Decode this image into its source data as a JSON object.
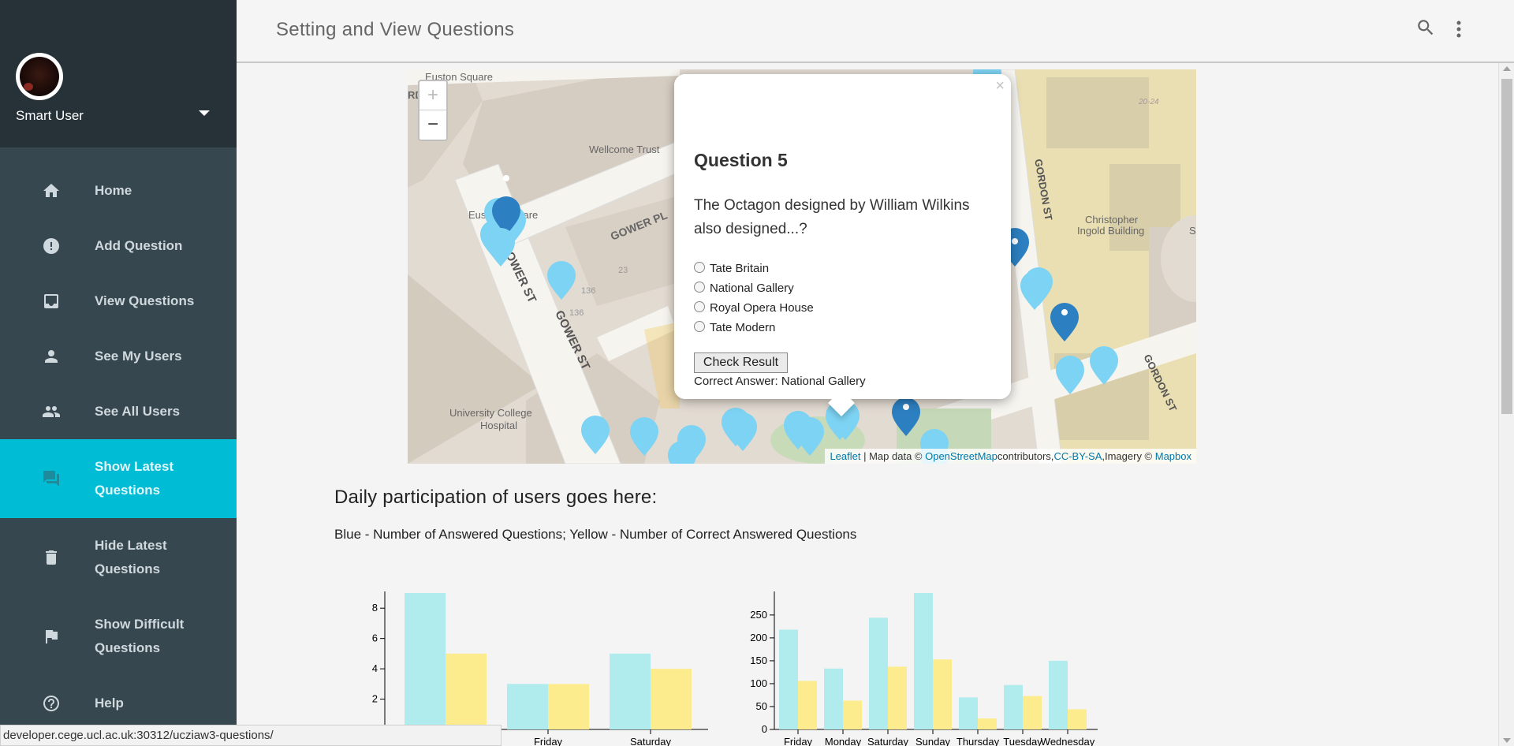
{
  "sidebar": {
    "user_name": "Smart User",
    "items": [
      {
        "label": "Home",
        "icon": "home-icon"
      },
      {
        "label": "Add Question",
        "icon": "alert-icon"
      },
      {
        "label": "View Questions",
        "icon": "inbox-icon"
      },
      {
        "label": "See My Users",
        "icon": "person-icon"
      },
      {
        "label": "See All Users",
        "icon": "people-icon"
      },
      {
        "label": "Show Latest Questions",
        "icon": "forum-icon",
        "active": true
      },
      {
        "label": "Hide Latest Questions",
        "icon": "trash-icon"
      },
      {
        "label": "Show Difficult Questions",
        "icon": "flag-icon"
      },
      {
        "label": "Help",
        "icon": "help-icon"
      }
    ],
    "active_color": "#00bcd4"
  },
  "header": {
    "title": "Setting and View Questions"
  },
  "map": {
    "zoom_in": "+",
    "zoom_out": "−",
    "labels": {
      "euston_square": "Euston Square",
      "euston_square_2": "Eus",
      "euston_square_3": "quare",
      "wellcome": "Wellcome Trust",
      "gower_pl": "GOWER PL",
      "gower_st_1": "GOWER ST",
      "gower_st_2": "GOWER ST",
      "gordon_st": "GORDON ST",
      "gordon_st_2": "GORDON ST",
      "christopher": "Christopher",
      "ingold": "Ingold Building",
      "ucl_hospital_1": "University College",
      "ucl_hospital_2": "Hospital",
      "n136a": "136",
      "n136b": "136",
      "n23": "23",
      "n2024": "20-24",
      "rd": "RD",
      "s": "S"
    },
    "attribution": {
      "leaflet": "Leaflet",
      "sep1": " | Map data © ",
      "osm": "OpenStreetMap",
      "contrib": "contributors,",
      "cc": "CC-BY-SA",
      "imagery": ",Imagery © ",
      "mapbox": "Mapbox"
    },
    "popup": {
      "close": "×",
      "title": "Question 5",
      "question": "The Octagon designed by William Wilkins also designed...?",
      "options": [
        "Tate Britain",
        "National Gallery",
        "Royal Opera House",
        "Tate Modern"
      ],
      "button": "Check Result",
      "correct": "Correct Answer: National Gallery"
    }
  },
  "main": {
    "section_title": "Daily participation of users goes here:",
    "legend": "Blue - Number of Answered Questions; Yellow - Number of Correct Answered Questions"
  },
  "status_bar": {
    "url": "developer.cege.ucl.ac.uk:30312/ucziaw3-questions/"
  },
  "chart_data": [
    {
      "type": "bar",
      "categories": [
        "",
        "Friday",
        "Saturday"
      ],
      "series": [
        {
          "values": [
            9,
            3,
            5
          ],
          "color": "#b0ebee"
        },
        {
          "values": [
            5,
            3,
            4
          ],
          "color": "#fdec8e"
        }
      ],
      "yticks": [
        2,
        4,
        6,
        8
      ],
      "ylim": [
        0,
        9
      ]
    },
    {
      "type": "bar",
      "categories": [
        "Friday",
        "Monday",
        "Saturday",
        "Sunday",
        "Thursday",
        "Tuesday",
        "Wednesday"
      ],
      "series": [
        {
          "values": [
            218,
            133,
            244,
            298,
            70,
            97,
            150
          ],
          "color": "#b0ebee"
        },
        {
          "values": [
            106,
            63,
            137,
            153,
            24,
            73,
            44
          ],
          "color": "#fdec8e"
        }
      ],
      "yticks": [
        0,
        50,
        100,
        150,
        200,
        250
      ],
      "ylim": [
        0,
        298
      ]
    }
  ]
}
